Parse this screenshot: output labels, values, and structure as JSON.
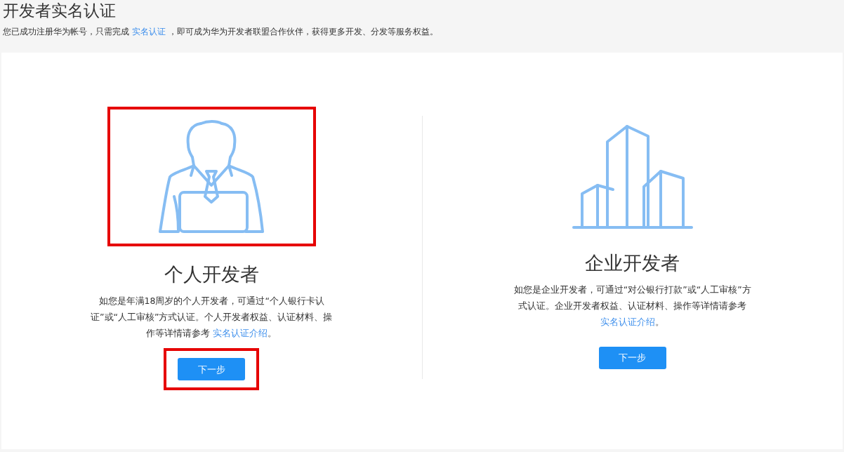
{
  "header": {
    "title": "开发者实名认证",
    "intro_before": "您已成功注册华为帐号，只需完成",
    "intro_link": "实名认证",
    "intro_after": "，即可成为华为开发者联盟合作伙伴，获得更多开发、分发等服务权益。"
  },
  "options": [
    {
      "kind": "personal",
      "highlighted": true,
      "title": "个人开发者",
      "description": "如您是年满18周岁的个人开发者，可通过“个人银行卡认证”或“人工审核”方式认证。个人开发者权益、认证材料、操作等详情请参考",
      "link": "实名认证介绍",
      "suffix": "。",
      "button": "下一步"
    },
    {
      "kind": "enterprise",
      "highlighted": false,
      "title": "企业开发者",
      "description": "如您是企业开发者，可通过“对公银行打款”或“人工审核”方式认证。企业开发者权益、认证材料、操作等详情请参考",
      "link": "实名认证介绍",
      "suffix": "。",
      "button": "下一步"
    }
  ]
}
